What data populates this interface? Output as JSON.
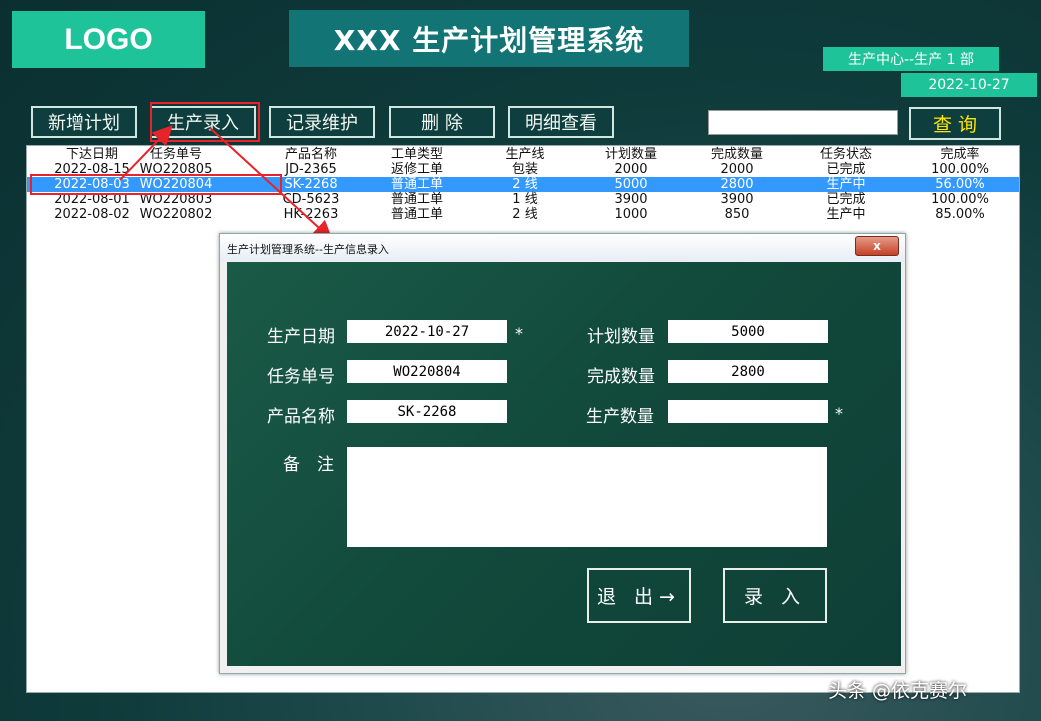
{
  "header": {
    "logo": "LOGO",
    "title": "XXX 生产计划管理系统",
    "department": "生产中心--生产 1 部",
    "date": "2022-10-27"
  },
  "toolbar": {
    "add_plan": "新增计划",
    "production_entry": "生产录入",
    "record_maintenance": "记录维护",
    "delete": "删 除",
    "detail_view": "明细查看",
    "search_value": "",
    "query": "查 询"
  },
  "table": {
    "columns": [
      "下达日期",
      "任务单号",
      "产品名称",
      "工单类型",
      "生产线",
      "计划数量",
      "完成数量",
      "任务状态",
      "完成率"
    ],
    "rows": [
      [
        "2022-08-15",
        "WO220805",
        "JD-2365",
        "返修工单",
        "包装",
        "2000",
        "2000",
        "已完成",
        "100.00%"
      ],
      [
        "2022-08-03",
        "WO220804",
        "SK-2268",
        "普通工单",
        "2 线",
        "5000",
        "2800",
        "生产中",
        "56.00%"
      ],
      [
        "2022-08-01",
        "WO220803",
        "CD-5623",
        "普通工单",
        "1 线",
        "3900",
        "3900",
        "已完成",
        "100.00%"
      ],
      [
        "2022-08-02",
        "WO220802",
        "HK-2263",
        "普通工单",
        "2 线",
        "1000",
        "850",
        "生产中",
        "85.00%"
      ]
    ],
    "selected_row": 1
  },
  "dialog": {
    "title": "生产计划管理系统--生产信息录入",
    "close": "x",
    "fields": {
      "production_date_label": "生产日期",
      "production_date": "2022-10-27",
      "task_no_label": "任务单号",
      "task_no": "WO220804",
      "product_name_label": "产品名称",
      "product_name": "SK-2268",
      "planned_qty_label": "计划数量",
      "planned_qty": "5000",
      "completed_qty_label": "完成数量",
      "completed_qty": "2800",
      "produced_qty_label": "生产数量",
      "produced_qty": "",
      "remarks_label": "备　注",
      "remarks": "",
      "required_mark": "*"
    },
    "exit_button": "退 出→",
    "submit_button": "录 入"
  },
  "watermark": "头条 @依克赛尔",
  "colors": {
    "accent": "#1fc39a",
    "title_bg": "#127475",
    "selection": "#3399ff",
    "annotation": "#e8232a"
  }
}
